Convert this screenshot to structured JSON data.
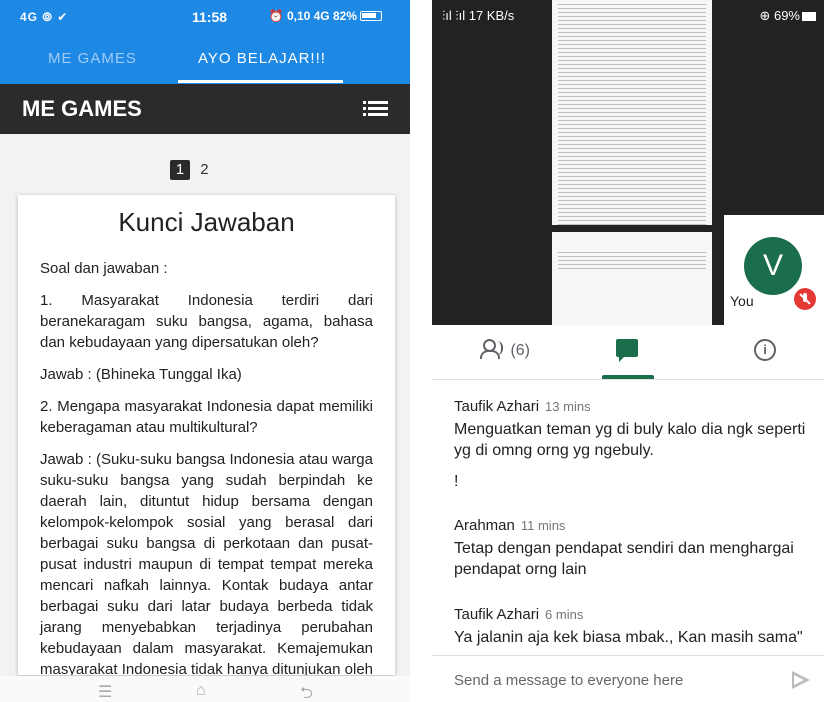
{
  "left_phone": {
    "status": {
      "left_icons": "4G ⦾ ✔",
      "time": "11:58",
      "right_info": "⏰ 0,10 4G 82%"
    },
    "tabs": [
      {
        "label": "ME GAMES",
        "active": false
      },
      {
        "label": "AYO BELAJAR!!!",
        "active": true
      }
    ],
    "header": {
      "title": "ME GAMES",
      "menu_icon": "list-menu-icon"
    },
    "pagination": {
      "pages": [
        "1",
        "2"
      ],
      "current": "1"
    },
    "card": {
      "title": "Kunci Jawaban",
      "paragraphs": [
        "Soal dan jawaban :",
        "1. Masyarakat Indonesia terdiri dari beranekaragam suku bangsa, agama, bahasa dan kebudayaan yang dipersatukan oleh?",
        "Jawab : (Bhineka Tunggal Ika)",
        "2. Mengapa masyarakat Indonesia dapat memiliki keberagaman atau multikultural?",
        "Jawab : (Suku-suku bangsa Indonesia atau warga suku-suku bangsa yang sudah berpindah ke daerah lain, dituntut hidup bersama dengan kelompok-kelompok sosial yang berasal dari berbagai suku bangsa di perkotaan dan pusat-pusat industri maupun di tempat tempat mereka mencari nafkah lainnya. Kontak budaya antar berbagai suku dari latar budaya berbeda tidak jarang menyebabkan terjadinya perubahan kebudayaan dalam masyarakat. Kemajemukan masyarakat Indonesia tidak hanya ditunjukan oleh beranekaragamnya corak kesukubangsaan"
      ]
    },
    "nav_icons": [
      "menu-icon",
      "home-icon",
      "back-icon"
    ]
  },
  "right_phone": {
    "status": {
      "left": "⫶ıl ⫶ıl 17 KB/s",
      "right": "⊕ 69%"
    },
    "self_tile": {
      "initial": "V",
      "label": "You",
      "avatar_color": "#1b6e4c",
      "mic_state": "muted"
    },
    "tabs": {
      "people_count": "(6)",
      "active": "chat"
    },
    "messages": [
      {
        "author": "Taufik Azhari",
        "time": "13 mins",
        "text": "Menguatkan teman yg di buly kalo dia ngk seperti yg di omng orng yg ngebuly.",
        "extra": "!"
      },
      {
        "author": "Arahman",
        "time": "11 mins",
        "text": "Tetap dengan pendapat sendiri dan menghargai pendapat orng lain",
        "extra": ""
      },
      {
        "author": "Taufik Azhari",
        "time": "6 mins",
        "text": "Ya jalanin aja kek biasa mbak., Kan masih sama\"",
        "extra": ""
      }
    ],
    "composer": {
      "placeholder": "Send a message to everyone here"
    }
  },
  "colors": {
    "left_accent": "#1e88e5",
    "left_header": "#2b2b2b",
    "meet_green": "#1b6e4c",
    "mute_red": "#e53935"
  }
}
